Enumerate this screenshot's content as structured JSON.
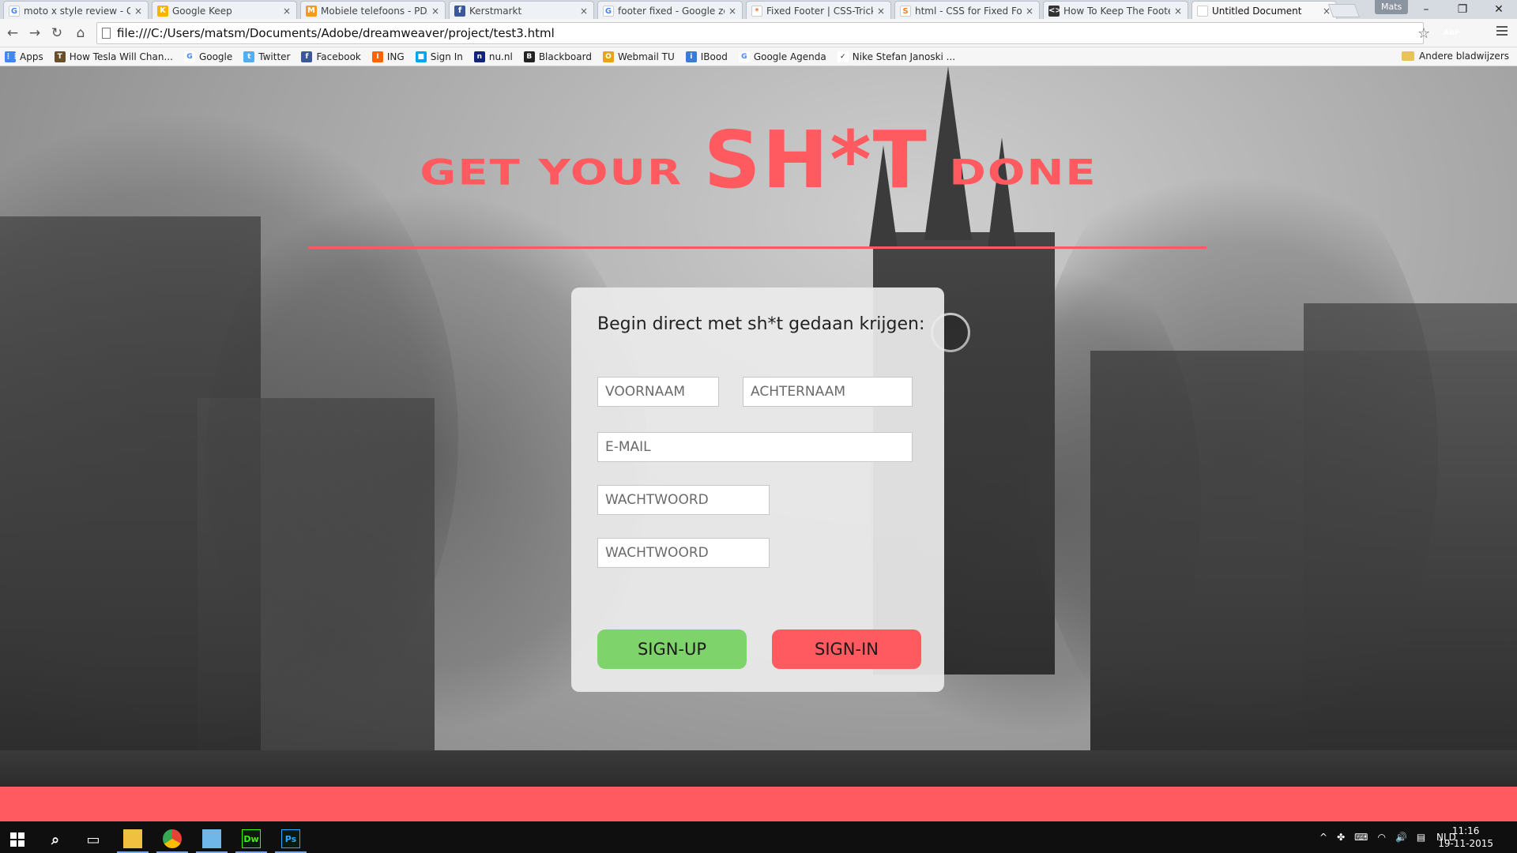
{
  "browser": {
    "tabs": [
      {
        "label": "moto x style review - Go",
        "favicon": "G",
        "color": "#ffffff",
        "fg": "#4285f4"
      },
      {
        "label": "Google Keep",
        "favicon": "K",
        "color": "#f4b400",
        "fg": "#ffffff"
      },
      {
        "label": "Mobiele telefoons - PDA",
        "favicon": "M",
        "color": "#f29b1d",
        "fg": "#ffffff"
      },
      {
        "label": "Kerstmarkt",
        "favicon": "f",
        "color": "#3b5998",
        "fg": "#ffffff"
      },
      {
        "label": "footer fixed - Google zo",
        "favicon": "G",
        "color": "#ffffff",
        "fg": "#4285f4"
      },
      {
        "label": "Fixed Footer | CSS-Tricks",
        "favicon": "*",
        "color": "#ffffff",
        "fg": "#e8762d"
      },
      {
        "label": "html - CSS for Fixed Foo",
        "favicon": "S",
        "color": "#ffffff",
        "fg": "#f48024"
      },
      {
        "label": "How To Keep The Footer",
        "favicon": "<>",
        "color": "#333333",
        "fg": "#ffffff"
      },
      {
        "label": "Untitled Document",
        "favicon": "",
        "color": "#ffffff",
        "fg": "#888888"
      }
    ],
    "close_glyph": "×",
    "user": "Mats",
    "window_buttons": [
      "–",
      "❐",
      "✕"
    ],
    "address": "file:///C:/Users/matsm/Documents/Adobe/dreamweaver/project/test3.html",
    "nav": {
      "back": "←",
      "forward": "→",
      "reload": "↻",
      "home": "⌂"
    },
    "star": "☆",
    "extensions": [
      {
        "name": "adblock-icon",
        "label": "ABP",
        "color": "#d0212a"
      },
      {
        "name": "extension-icon",
        "label": "",
        "color": "#b8b8b8"
      }
    ],
    "bookmarks": [
      {
        "label": "Apps",
        "icon": "apps-icon",
        "color": "#4285f4",
        "glyph": "⋮⋮"
      },
      {
        "label": "How Tesla Will Chan...",
        "icon": "page-icon",
        "color": "#6b4f2a",
        "glyph": "T"
      },
      {
        "label": "Google",
        "icon": "google-icon",
        "color": "#ffffff",
        "glyph": "G",
        "fg": "#4285f4"
      },
      {
        "label": "Twitter",
        "icon": "twitter-icon",
        "color": "#55acee",
        "glyph": "t"
      },
      {
        "label": "Facebook",
        "icon": "facebook-icon",
        "color": "#3b5998",
        "glyph": "f"
      },
      {
        "label": "ING",
        "icon": "ing-icon",
        "color": "#ff6200",
        "glyph": "I"
      },
      {
        "label": "Sign In",
        "icon": "microsoft-icon",
        "color": "#00a4ef",
        "glyph": "■"
      },
      {
        "label": "nu.nl",
        "icon": "nunl-icon",
        "color": "#12237a",
        "glyph": "n"
      },
      {
        "label": "Blackboard",
        "icon": "blackboard-icon",
        "color": "#222222",
        "glyph": "B"
      },
      {
        "label": "Webmail TU",
        "icon": "mail-icon",
        "color": "#e8a317",
        "glyph": "O"
      },
      {
        "label": "IBood",
        "icon": "ibood-icon",
        "color": "#3a7bd5",
        "glyph": "i"
      },
      {
        "label": "Google Agenda",
        "icon": "google-icon",
        "color": "#ffffff",
        "glyph": "G",
        "fg": "#4285f4"
      },
      {
        "label": "Nike Stefan Janoski ...",
        "icon": "nike-icon",
        "color": "#ffffff",
        "glyph": "✓",
        "fg": "#111111"
      }
    ],
    "other_bookmarks": "Andere bladwijzers"
  },
  "page": {
    "headline_left": "Get your",
    "headline_big": "SH*T",
    "headline_right": "done",
    "accent": "#ff5a5f",
    "green": "#7ed36a",
    "form": {
      "title": "Begin direct met sh*t gedaan krijgen:",
      "firstname_placeholder": "VOORNAAM",
      "lastname_placeholder": "ACHTERNAAM",
      "email_placeholder": "E-MAIL",
      "password_placeholder": "WACHTWOORD",
      "password_confirm_placeholder": "WACHTWOORD",
      "signup_label": "SIGN-UP",
      "signin_label": "SIGN-IN"
    }
  },
  "taskbar": {
    "apps": [
      {
        "name": "search-icon",
        "glyph": "⌕"
      },
      {
        "name": "task-view-icon",
        "glyph": "▭"
      },
      {
        "name": "file-explorer-icon",
        "glyph": "",
        "color": "#f0c040"
      },
      {
        "name": "chrome-icon",
        "glyph": "",
        "color": "#e94235"
      },
      {
        "name": "notepad-icon",
        "glyph": "",
        "color": "#6fb7e8"
      },
      {
        "name": "dreamweaver-icon",
        "glyph": "Dw",
        "color": "#35fa00"
      },
      {
        "name": "photoshop-icon",
        "glyph": "Ps",
        "color": "#31a8ff"
      }
    ],
    "tray_glyphs": [
      "^",
      "✤",
      "⌨",
      "◠",
      "🔊",
      "▤"
    ],
    "language": "NLD",
    "time": "11:16",
    "date": "19-11-2015"
  }
}
